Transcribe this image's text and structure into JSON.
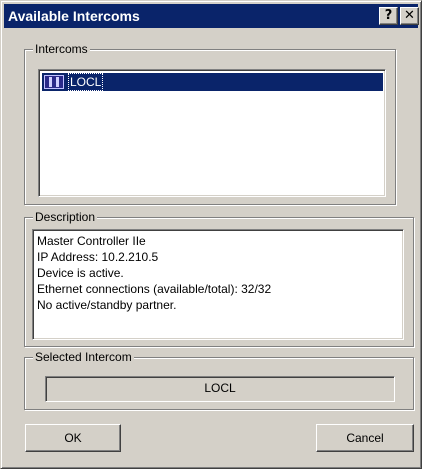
{
  "window": {
    "title": "Available Intercoms",
    "help_label": "?",
    "close_label": "✕"
  },
  "intercoms": {
    "legend": "Intercoms",
    "items": [
      {
        "label": "LOCL",
        "icon": "intercom-icon",
        "selected": true
      }
    ]
  },
  "description": {
    "legend": "Description",
    "lines": [
      "Master Controller IIe",
      "IP Address: 10.2.210.5",
      "Device is active.",
      "Ethernet connections (available/total): 32/32",
      "No active/standby partner."
    ]
  },
  "selected_intercom": {
    "legend": "Selected Intercom",
    "value": "LOCL"
  },
  "buttons": {
    "ok_label": "OK",
    "cancel_label": "Cancel"
  },
  "colors": {
    "title_bar": "#0a246a",
    "face": "#d4d0c8",
    "selection": "#0a246a"
  }
}
